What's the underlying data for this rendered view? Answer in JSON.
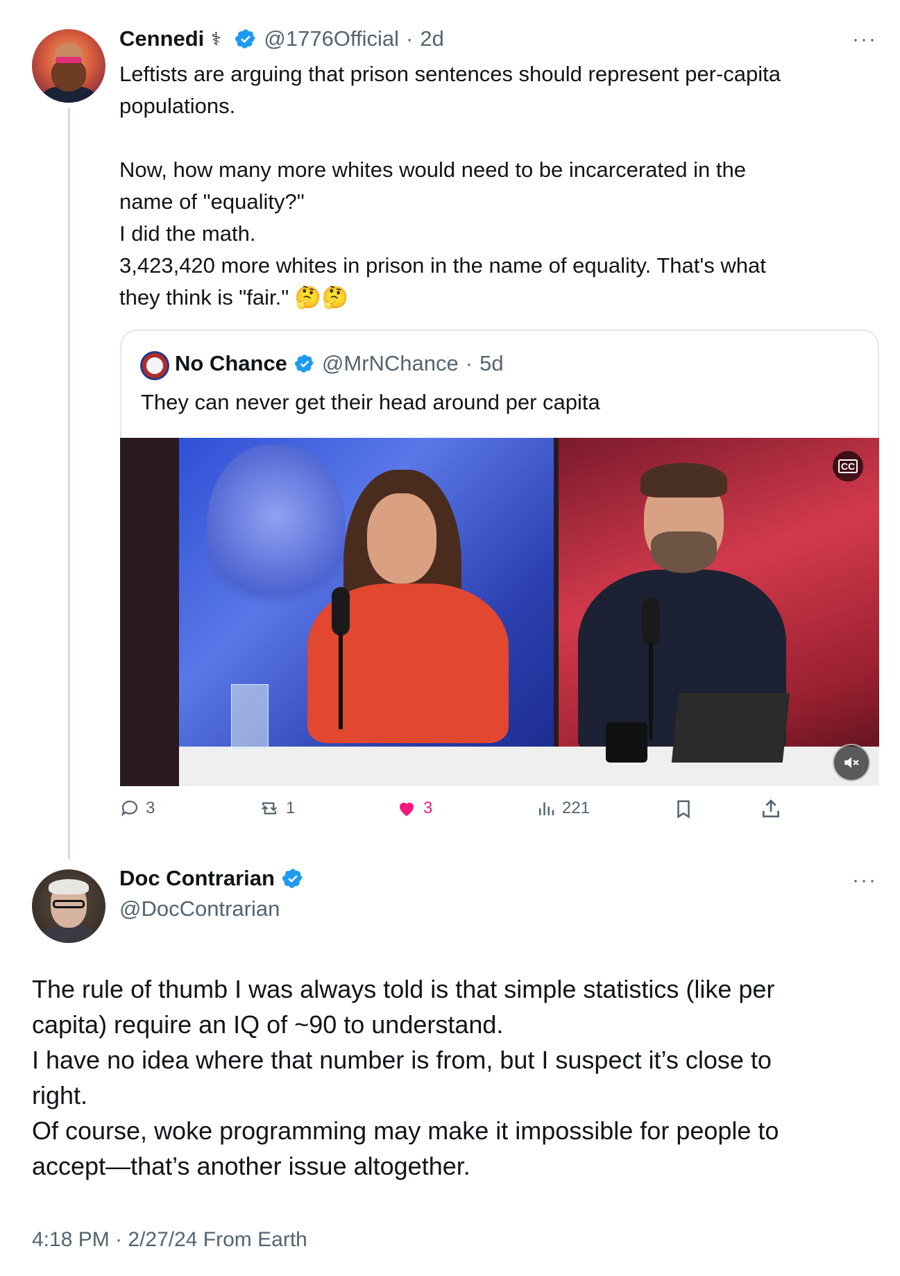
{
  "quoting_tweet": {
    "author_name": "Cennedi",
    "name_glyph": "⚕",
    "handle": "@1776Official",
    "time": "2d",
    "separator": "·",
    "text": "Leftists are arguing that prison sentences should represent per-capita\npopulations.\n\nNow, how many more whites would need to be incarcerated in the\nname of \"equality?\"\nI did the math.\n3,423,420 more whites in prison in the name of equality. That's what\nthey think is \"fair.\" 🤔🤔",
    "quoted": {
      "author_name": "No Chance",
      "handle": "@MrNChance",
      "time": "5d",
      "text": "They can never get their head around per capita"
    },
    "actions": {
      "replies": "3",
      "reposts": "1",
      "likes": "3",
      "views": "221"
    }
  },
  "main_tweet": {
    "author_name": "Doc Contrarian",
    "handle": "@DocContrarian",
    "text": "The rule of thumb I was always told is that simple statistics (like per\ncapita) require an IQ of ~90 to understand.\nI have no idea where that number is from, but I suspect it’s close to\nright.\nOf course, woke programming may make it impossible for people to\naccept—that’s another issue altogether.",
    "timestamp": "4:18 PM · 2/27/24 From Earth"
  },
  "ui": {
    "more_label": "···",
    "cc_label": "CC",
    "accent_color": "#1d9bf0",
    "like_color": "#f91880",
    "icons": [
      "verified-badge-icon",
      "reply-icon",
      "repost-icon",
      "heart-icon",
      "views-icon",
      "bookmark-icon",
      "share-icon",
      "captions-icon",
      "mute-icon",
      "more-icon"
    ]
  }
}
